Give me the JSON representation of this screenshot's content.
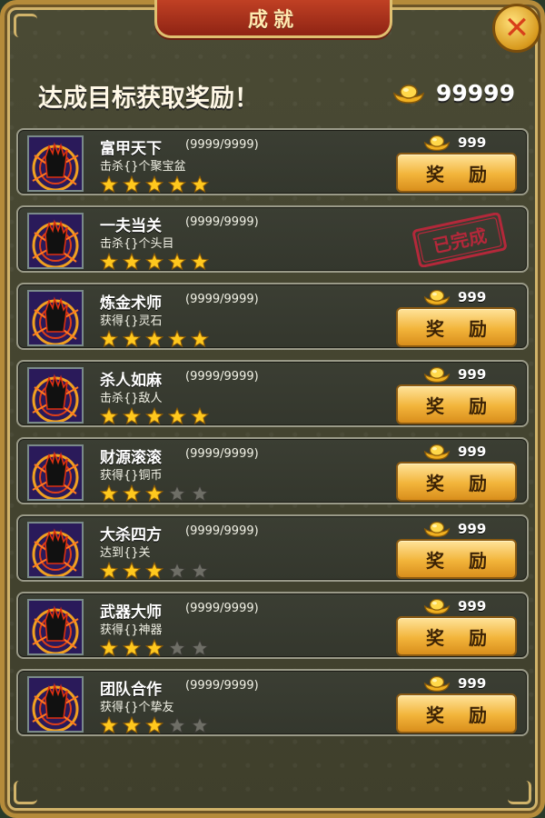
{
  "window": {
    "title": "成就",
    "close_icon": "close-icon"
  },
  "header": {
    "headline": "达成目标获取奖励！",
    "total_currency": "99999",
    "currency_icon": "gold-ingot-icon"
  },
  "stamp_text": "已完成",
  "colors": {
    "panel": "#4a4a34",
    "frame": "#b58b3a",
    "title_tab": "#c04024",
    "button": "#f2b43a",
    "stamp": "#b4283a"
  },
  "achievements": [
    {
      "name": "富甲天下",
      "progress": "(9999/9999)",
      "desc": "击杀{}个聚宝盆",
      "stars": 5,
      "max_stars": 5,
      "reward": "999",
      "button": "奖 励",
      "completed": false
    },
    {
      "name": "一夫当关",
      "progress": "(9999/9999)",
      "desc": "击杀{}个头目",
      "stars": 5,
      "max_stars": 5,
      "reward": "",
      "button": "",
      "completed": true
    },
    {
      "name": "炼金术师",
      "progress": "(9999/9999)",
      "desc": "获得{}灵石",
      "stars": 5,
      "max_stars": 5,
      "reward": "999",
      "button": "奖 励",
      "completed": false
    },
    {
      "name": "杀人如麻",
      "progress": "(9999/9999)",
      "desc": "击杀{}敌人",
      "stars": 5,
      "max_stars": 5,
      "reward": "999",
      "button": "奖 励",
      "completed": false
    },
    {
      "name": "财源滚滚",
      "progress": "(9999/9999)",
      "desc": "获得{}铜币",
      "stars": 3,
      "max_stars": 5,
      "reward": "999",
      "button": "奖 励",
      "completed": false
    },
    {
      "name": "大杀四方",
      "progress": "(9999/9999)",
      "desc": "达到{}关",
      "stars": 3,
      "max_stars": 5,
      "reward": "999",
      "button": "奖 励",
      "completed": false
    },
    {
      "name": "武器大师",
      "progress": "(9999/9999)",
      "desc": "获得{}神器",
      "stars": 3,
      "max_stars": 5,
      "reward": "999",
      "button": "奖 励",
      "completed": false
    },
    {
      "name": "团队合作",
      "progress": "(9999/9999)",
      "desc": "获得{}个挚友",
      "stars": 3,
      "max_stars": 5,
      "reward": "999",
      "button": "奖 励",
      "completed": false
    }
  ]
}
